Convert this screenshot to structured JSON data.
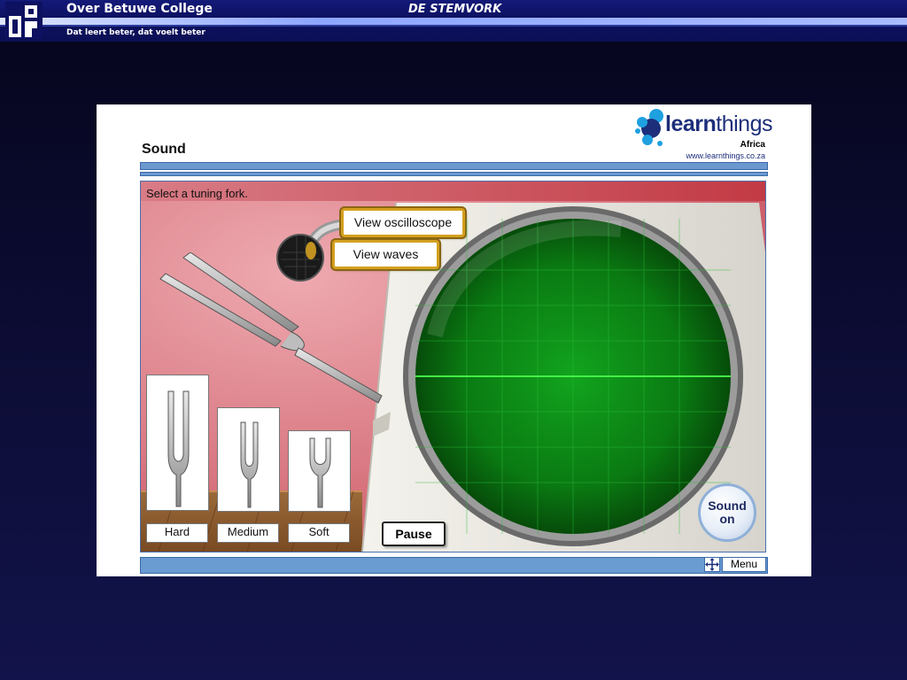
{
  "header": {
    "college_name": "Over Betuwe College",
    "tagline": "Dat leert beter, dat voelt beter",
    "app_title": "DE STEMVORK"
  },
  "panel": {
    "heading": "Sound",
    "brand": {
      "word_bold": "learn",
      "word_regular": "things",
      "region": "Africa",
      "url": "www.learnthings.co.za"
    }
  },
  "stage": {
    "instruction": "Select a tuning fork.",
    "view_oscilloscope": "View oscilloscope",
    "view_waves": "View waves",
    "forks": [
      {
        "label": "Hard"
      },
      {
        "label": "Medium"
      },
      {
        "label": "Soft"
      }
    ],
    "pause_label": "Pause",
    "sound_label_line1": "Sound",
    "sound_label_line2": "on"
  },
  "footer": {
    "menu_label": "Menu"
  },
  "colors": {
    "accent_blue": "#6a9bd1",
    "gold_border": "#d4a020",
    "scope_green": "#0a8a12",
    "wall_red": "#d06a74"
  }
}
